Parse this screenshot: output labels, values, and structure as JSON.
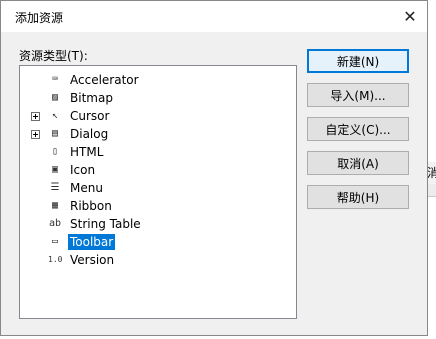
{
  "behind": {
    "tail_text": "消"
  },
  "dialog": {
    "title": "添加资源",
    "close_glyph": "✕",
    "list_label": "资源类型(T):",
    "items": [
      {
        "label": "Accelerator",
        "icon": "accelerator-icon",
        "icon_glyph": "⌨",
        "expandable": false,
        "selected": false
      },
      {
        "label": "Bitmap",
        "icon": "bitmap-icon",
        "icon_glyph": "▨",
        "expandable": false,
        "selected": false
      },
      {
        "label": "Cursor",
        "icon": "cursor-icon",
        "icon_glyph": "↖",
        "expandable": true,
        "selected": false
      },
      {
        "label": "Dialog",
        "icon": "dialog-icon",
        "icon_glyph": "▤",
        "expandable": true,
        "selected": false
      },
      {
        "label": "HTML",
        "icon": "html-icon",
        "icon_glyph": "▯",
        "expandable": false,
        "selected": false
      },
      {
        "label": "Icon",
        "icon": "icon-resource-icon",
        "icon_glyph": "▣",
        "expandable": false,
        "selected": false
      },
      {
        "label": "Menu",
        "icon": "menu-icon",
        "icon_glyph": "☰",
        "expandable": false,
        "selected": false
      },
      {
        "label": "Ribbon",
        "icon": "ribbon-icon",
        "icon_glyph": "▦",
        "expandable": false,
        "selected": false
      },
      {
        "label": "String Table",
        "icon": "string-table-icon",
        "icon_glyph": "ab",
        "expandable": false,
        "selected": false
      },
      {
        "label": "Toolbar",
        "icon": "toolbar-icon",
        "icon_glyph": "▭",
        "expandable": false,
        "selected": true
      },
      {
        "label": "Version",
        "icon": "version-icon",
        "icon_glyph": "1.0",
        "expandable": false,
        "selected": false
      }
    ],
    "buttons": {
      "new": "新建(N)",
      "import": "导入(M)...",
      "custom": "自定义(C)...",
      "cancel": "取消(A)",
      "help": "帮助(H)"
    },
    "colors": {
      "selection": "#0078d7",
      "default_button_border": "#0078d7"
    }
  }
}
